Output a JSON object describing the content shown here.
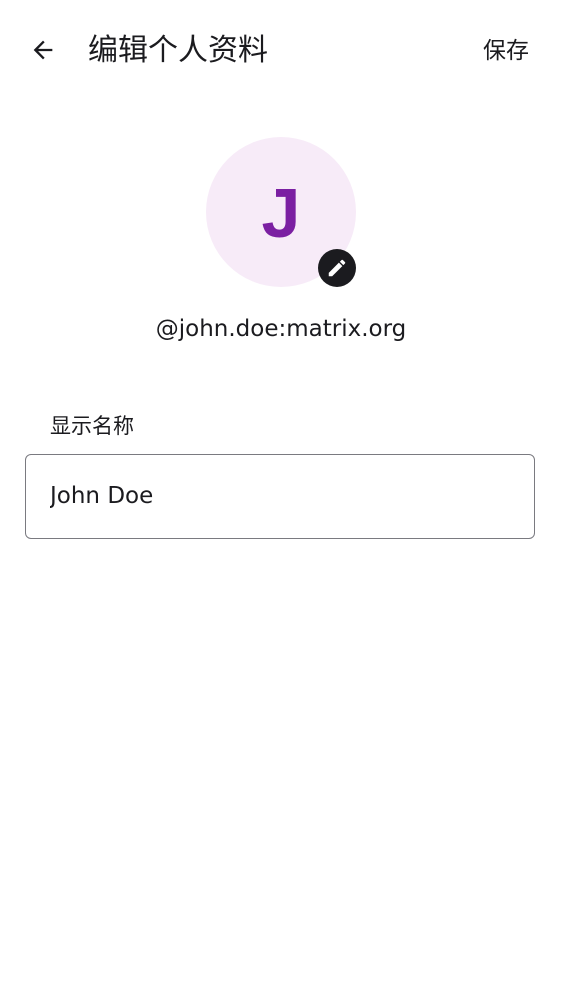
{
  "header": {
    "title": "编辑个人资料",
    "save_label": "保存",
    "back_icon": "arrow-back-icon"
  },
  "profile": {
    "avatar_initial": "J",
    "avatar_bg_color": "#f7ebf8",
    "avatar_text_color": "#7b1fa2",
    "edit_icon": "pencil-icon",
    "user_id": "@john.doe:matrix.org"
  },
  "form": {
    "display_name_label": "显示名称",
    "display_name_value": "John Doe"
  }
}
